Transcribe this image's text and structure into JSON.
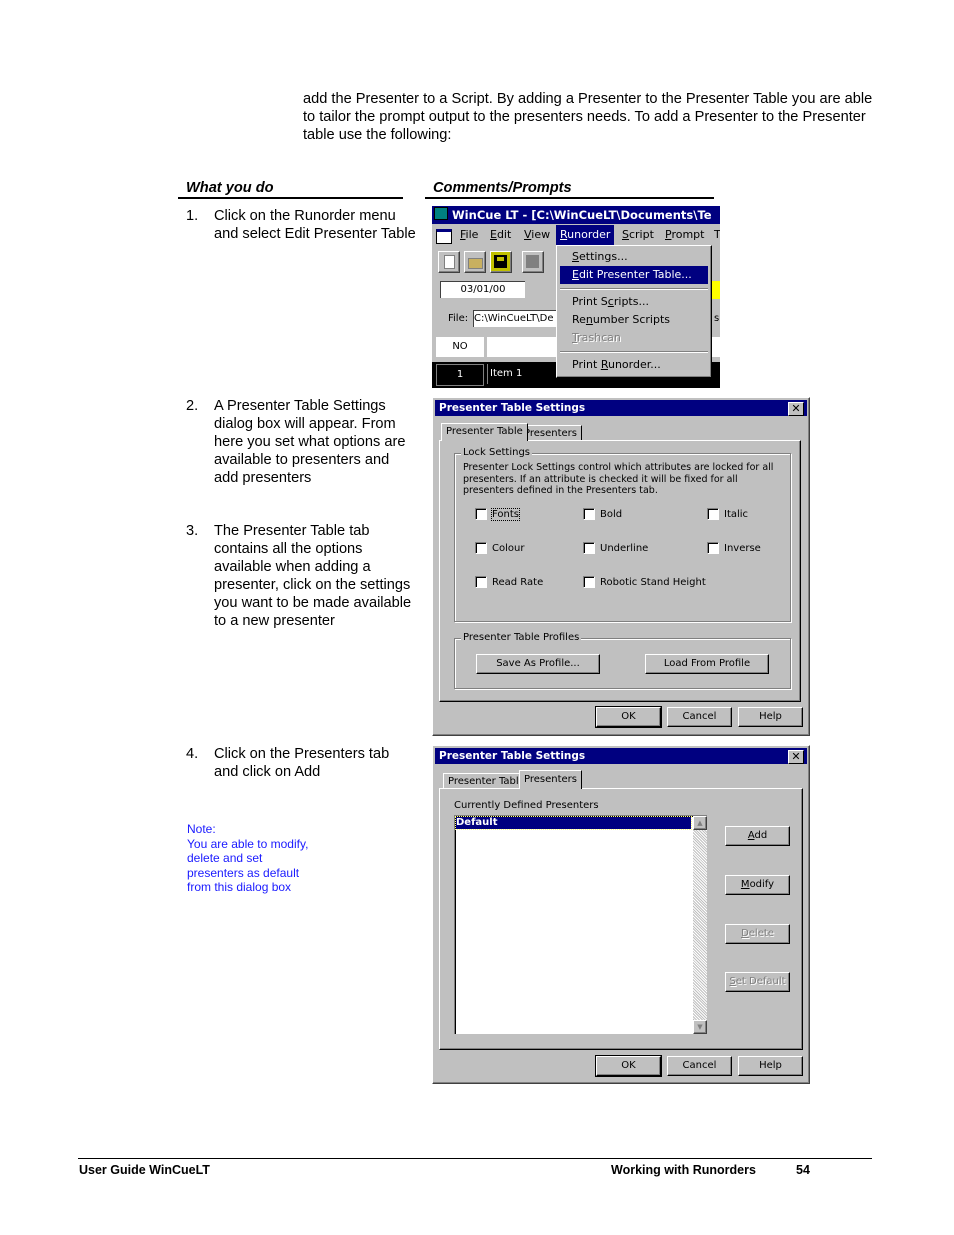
{
  "intro": "add the Presenter to a Script. By adding a Presenter to the Presenter Table you are able to tailor the prompt output to the presenters needs. To add a Presenter to the Presenter table use the following:",
  "columns": {
    "left": "What you do",
    "right": "Comments/Prompts"
  },
  "steps": [
    {
      "num": "1.",
      "text": "Click on the Runorder menu and select Edit Presenter Table"
    },
    {
      "num": "2.",
      "text": "A Presenter Table Settings dialog box will appear. From here you set what options are available to presenters and add presenters"
    },
    {
      "num": "3.",
      "text": "The Presenter Table tab contains all the options available when adding a presenter, click on the settings you want to be made available to a new presenter"
    },
    {
      "num": "4.",
      "text": "Click on the Presenters tab and click on Add"
    }
  ],
  "note": {
    "title": "Note:",
    "lines": [
      "You are able to modify,",
      "delete and set",
      "presenters as default",
      "from this dialog box"
    ]
  },
  "screenshot1": {
    "title": "WinCue LT - [C:\\WinCueLT\\Documents\\Te",
    "menus": [
      "File",
      "Edit",
      "View",
      "Runorder",
      "Script",
      "Prompt",
      "T"
    ],
    "active_menu": "Runorder",
    "date": "03/01/00",
    "file_label": "File:",
    "file_value": "C:\\WinCueLT\\De",
    "col_no": "NO",
    "row_num": "1",
    "row_item": "Item 1",
    "runorder_menu": {
      "items": [
        "Settings...",
        "Edit Presenter Table...",
        "Print Scripts...",
        "Renumber Scripts",
        "Trashcan",
        "Print Runorder..."
      ],
      "highlighted": "Edit Presenter Table...",
      "disabled": [
        "Trashcan"
      ]
    },
    "accent": "#000080",
    "yellow": "#ffff00"
  },
  "dialog1": {
    "title": "Presenter Table Settings",
    "tabs": [
      "Presenter Table",
      "Presenters"
    ],
    "active_tab": "Presenter Table",
    "lock_group": "Lock Settings",
    "lock_desc": "Presenter Lock Settings control which attributes are locked for all presenters. If an attribute is checked it will be fixed for all presenters defined in the Presenters tab.",
    "checkboxes": [
      {
        "label": "Fonts",
        "checked": false
      },
      {
        "label": "Bold",
        "checked": false
      },
      {
        "label": "Italic",
        "checked": false
      },
      {
        "label": "Colour",
        "checked": false
      },
      {
        "label": "Underline",
        "checked": false
      },
      {
        "label": "Inverse",
        "checked": false
      },
      {
        "label": "Read Rate",
        "checked": false
      },
      {
        "label": "Robotic Stand Height",
        "checked": false
      }
    ],
    "profiles_group": "Presenter Table Profiles",
    "save_profile": "Save As Profile...",
    "load_profile": "Load From Profile",
    "ok": "OK",
    "cancel": "Cancel",
    "help": "Help"
  },
  "dialog2": {
    "title": "Presenter Table Settings",
    "tabs": [
      "Presenter Table",
      "Presenters"
    ],
    "active_tab": "Presenters",
    "list_label": "Currently Defined Presenters",
    "presenters": [
      "Default"
    ],
    "selected": "Default",
    "add": "Add",
    "modify": "Modify",
    "delete": "Delete",
    "set_default": "Set Default",
    "ok": "OK",
    "cancel": "Cancel",
    "help": "Help"
  },
  "footer": {
    "left": "User Guide WinCueLT",
    "section": "Working with Runorders",
    "page": "54"
  }
}
